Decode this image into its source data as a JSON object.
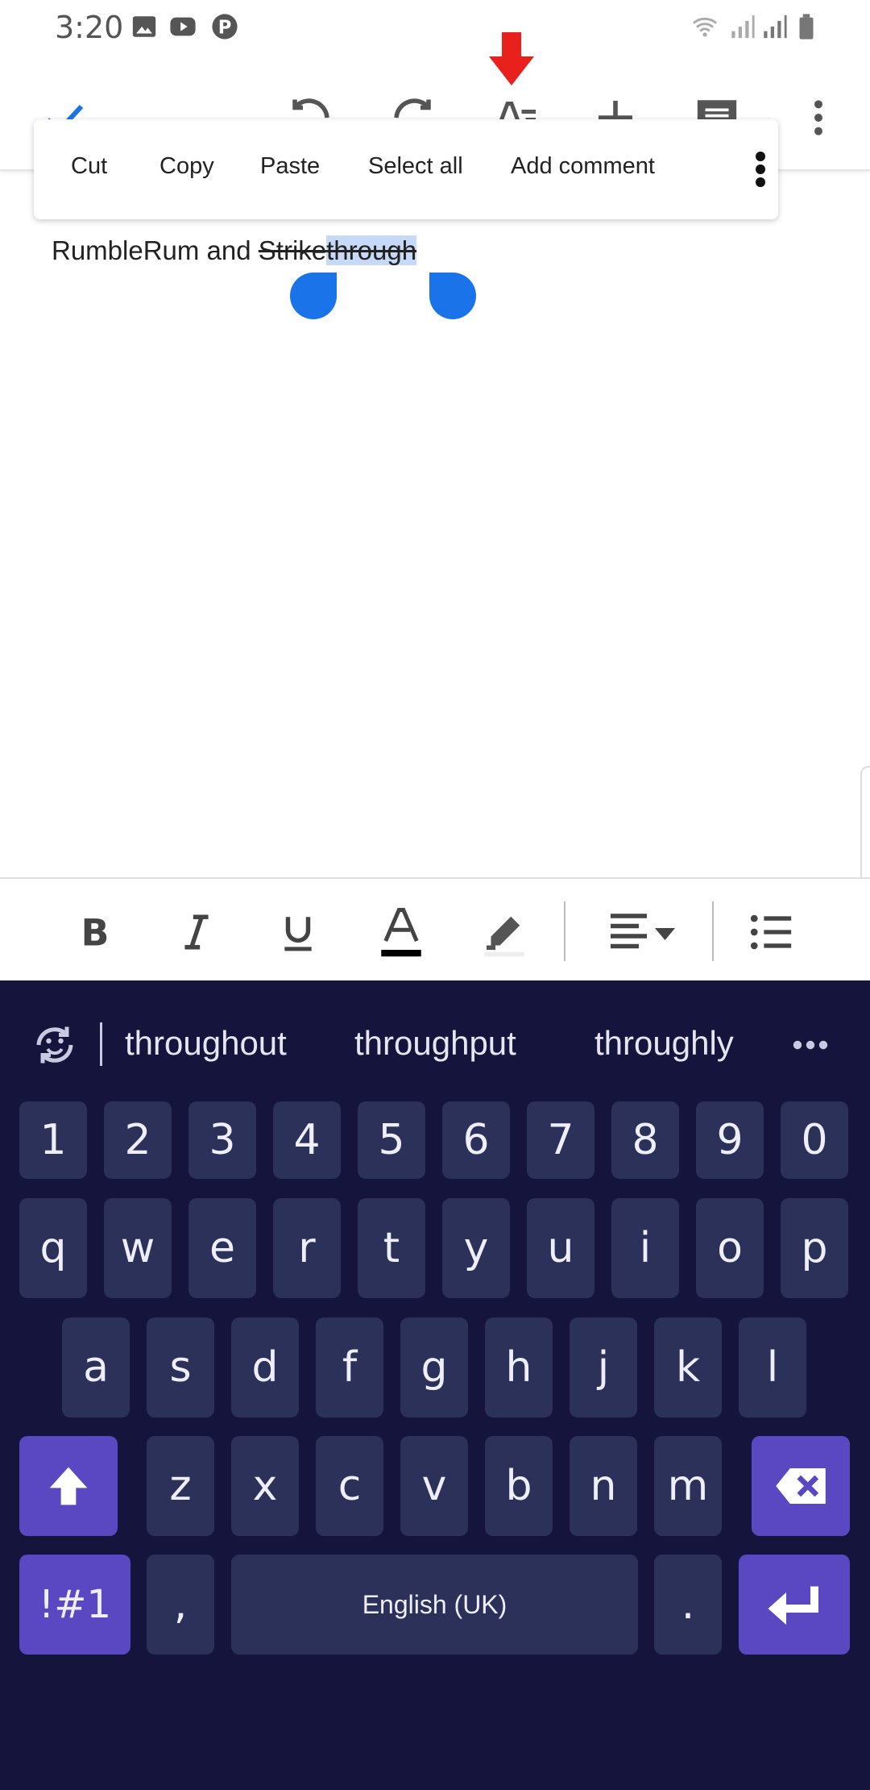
{
  "status_bar": {
    "time": "3:20",
    "icons": [
      "image-icon",
      "youtube-icon",
      "pinterest-icon",
      "wifi-icon",
      "signal-icon",
      "signal-icon",
      "battery-icon"
    ]
  },
  "toolbar": {
    "icons": [
      "check-icon",
      "undo-icon",
      "redo-icon",
      "text-format-icon",
      "add-icon",
      "comment-icon",
      "more-vert-icon"
    ],
    "accent_color": "#1a73e8"
  },
  "context_menu": {
    "items": [
      "Cut",
      "Copy",
      "Paste",
      "Select all",
      "Add comment"
    ]
  },
  "document": {
    "text_plain": "RumbleRum and ",
    "text_strike_unselected": "Strike",
    "text_strike_selected": "through"
  },
  "format_bar": {
    "icons": [
      "bold-icon",
      "italic-icon",
      "underline-icon",
      "text-color-icon",
      "highlight-icon",
      "align-icon",
      "list-icon"
    ]
  },
  "keyboard": {
    "suggestions": [
      "throughout",
      "throughput",
      "throughly"
    ],
    "number_row": [
      "1",
      "2",
      "3",
      "4",
      "5",
      "6",
      "7",
      "8",
      "9",
      "0"
    ],
    "row1": [
      "q",
      "w",
      "e",
      "r",
      "t",
      "y",
      "u",
      "i",
      "o",
      "p"
    ],
    "row2": [
      "a",
      "s",
      "d",
      "f",
      "g",
      "h",
      "j",
      "k",
      "l"
    ],
    "row3": [
      "z",
      "x",
      "c",
      "v",
      "b",
      "n",
      "m"
    ],
    "symbols_label": "!#1",
    "comma": ",",
    "space_label": "English (UK)",
    "period": ".",
    "background_color": "#14143d",
    "special_key_color": "#5a48c3"
  }
}
